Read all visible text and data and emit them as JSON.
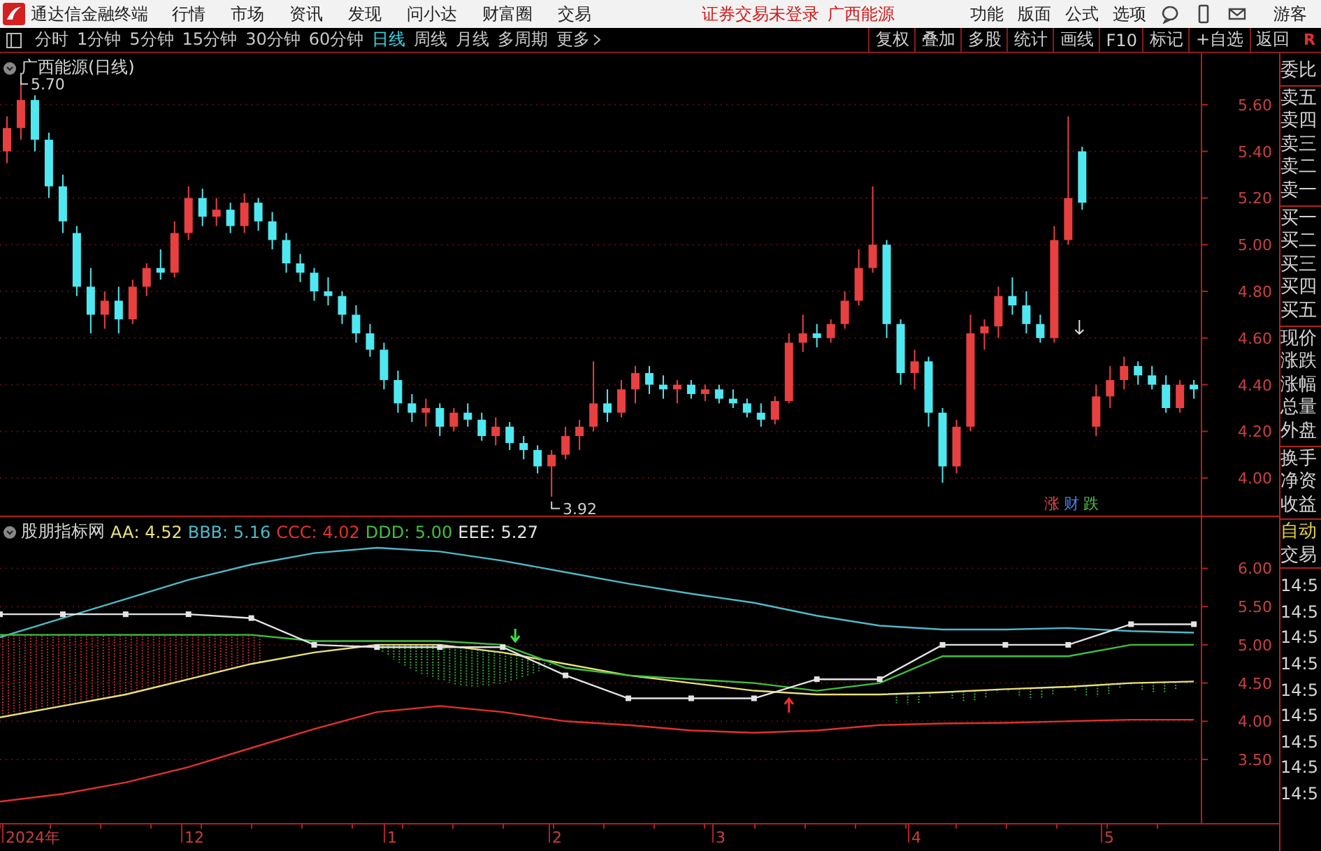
{
  "title_bar": {
    "app_name": "通达信金融终端",
    "menu": [
      "行情",
      "市场",
      "资讯",
      "发现",
      "问小达",
      "财富圈",
      "交易"
    ],
    "login_status": "证券交易未登录",
    "stock_name": "广西能源",
    "tools": [
      "功能",
      "版面",
      "公式",
      "选项"
    ],
    "user": "游客"
  },
  "period_bar": {
    "periods": [
      {
        "label": "分时",
        "selected": false
      },
      {
        "label": "1分钟",
        "selected": false
      },
      {
        "label": "5分钟",
        "selected": false
      },
      {
        "label": "15分钟",
        "selected": false
      },
      {
        "label": "30分钟",
        "selected": false
      },
      {
        "label": "60分钟",
        "selected": false
      },
      {
        "label": "日线",
        "selected": true
      },
      {
        "label": "周线",
        "selected": false
      },
      {
        "label": "月线",
        "selected": false
      },
      {
        "label": "多周期",
        "selected": false
      }
    ],
    "more": "更多",
    "actions": [
      "复权",
      "叠加",
      "多股",
      "统计",
      "画线",
      "F10",
      "标记",
      "+自选",
      "返回"
    ],
    "corner": "R"
  },
  "main_chart": {
    "title": "广西能源(日线)",
    "high_label": "5.70",
    "low_label": "3.92",
    "markers": [
      {
        "text": "涨",
        "color": "#e8484a"
      },
      {
        "text": "财",
        "color": "#4a7fe0"
      },
      {
        "text": "跌",
        "color": "#4ec24e"
      }
    ],
    "chart_data": {
      "type": "candlestick",
      "grid": true,
      "ylim": [
        3.84,
        5.82
      ],
      "categories": [
        null,
        null,
        null,
        null,
        null,
        null,
        null,
        null,
        null,
        null,
        null,
        null,
        null,
        null,
        null,
        null,
        null,
        null,
        null,
        null,
        null,
        null,
        null,
        null,
        null,
        null,
        null,
        null,
        null,
        null,
        null,
        null,
        null,
        null,
        null,
        null,
        null,
        null,
        null,
        null,
        null,
        null,
        null,
        null,
        null,
        null,
        null,
        null,
        null,
        null,
        null,
        null,
        null,
        null,
        null,
        null,
        null,
        null,
        null,
        null,
        null,
        null,
        null,
        null,
        null,
        null,
        null,
        null,
        null,
        null,
        null,
        null,
        null,
        null,
        null,
        null,
        null,
        null,
        null,
        null,
        null,
        null,
        null,
        null,
        null,
        null
      ],
      "yticks": [
        {
          "value": 5.6,
          "label": "5.60"
        },
        {
          "value": 5.4,
          "label": "5.40"
        },
        {
          "value": 5.2,
          "label": "5.20"
        },
        {
          "value": 5,
          "label": "5.00"
        },
        {
          "value": 4.8,
          "label": "4.80"
        },
        {
          "value": 4.6,
          "label": "4.60"
        },
        {
          "value": 4.4,
          "label": "4.40"
        },
        {
          "value": 4.2,
          "label": "4.20"
        },
        {
          "value": 4,
          "label": "4.00"
        }
      ],
      "ohlc": [
        [
          5.4,
          5.55,
          5.35,
          5.5
        ],
        [
          5.5,
          5.7,
          5.45,
          5.62
        ],
        [
          5.62,
          5.64,
          5.4,
          5.45
        ],
        [
          5.45,
          5.48,
          5.2,
          5.25
        ],
        [
          5.25,
          5.3,
          5.05,
          5.1
        ],
        [
          5.05,
          5.08,
          4.78,
          4.82
        ],
        [
          4.82,
          4.9,
          4.62,
          4.7
        ],
        [
          4.7,
          4.8,
          4.64,
          4.76
        ],
        [
          4.76,
          4.82,
          4.62,
          4.68
        ],
        [
          4.68,
          4.85,
          4.66,
          4.82
        ],
        [
          4.82,
          4.92,
          4.78,
          4.9
        ],
        [
          4.9,
          4.98,
          4.85,
          4.88
        ],
        [
          4.88,
          5.1,
          4.86,
          5.05
        ],
        [
          5.05,
          5.25,
          5.02,
          5.2
        ],
        [
          5.2,
          5.24,
          5.08,
          5.12
        ],
        [
          5.12,
          5.2,
          5.08,
          5.15
        ],
        [
          5.15,
          5.18,
          5.05,
          5.08
        ],
        [
          5.08,
          5.22,
          5.05,
          5.18
        ],
        [
          5.18,
          5.2,
          5.06,
          5.1
        ],
        [
          5.1,
          5.14,
          4.98,
          5.02
        ],
        [
          5.02,
          5.05,
          4.88,
          4.92
        ],
        [
          4.92,
          4.96,
          4.84,
          4.88
        ],
        [
          4.88,
          4.9,
          4.76,
          4.8
        ],
        [
          4.8,
          4.86,
          4.74,
          4.78
        ],
        [
          4.78,
          4.8,
          4.66,
          4.7
        ],
        [
          4.7,
          4.74,
          4.58,
          4.62
        ],
        [
          4.62,
          4.66,
          4.52,
          4.55
        ],
        [
          4.55,
          4.58,
          4.38,
          4.42
        ],
        [
          4.42,
          4.46,
          4.28,
          4.32
        ],
        [
          4.32,
          4.36,
          4.24,
          4.28
        ],
        [
          4.28,
          4.34,
          4.22,
          4.3
        ],
        [
          4.3,
          4.32,
          4.18,
          4.22
        ],
        [
          4.22,
          4.3,
          4.2,
          4.28
        ],
        [
          4.28,
          4.32,
          4.22,
          4.25
        ],
        [
          4.25,
          4.28,
          4.16,
          4.18
        ],
        [
          4.18,
          4.26,
          4.14,
          4.22
        ],
        [
          4.22,
          4.24,
          4.12,
          4.15
        ],
        [
          4.15,
          4.18,
          4.08,
          4.12
        ],
        [
          4.12,
          4.14,
          4.02,
          4.05
        ],
        [
          4.05,
          4.12,
          3.92,
          4.1
        ],
        [
          4.1,
          4.22,
          4.08,
          4.18
        ],
        [
          4.18,
          4.25,
          4.12,
          4.22
        ],
        [
          4.22,
          4.5,
          4.2,
          4.32
        ],
        [
          4.32,
          4.38,
          4.24,
          4.28
        ],
        [
          4.28,
          4.42,
          4.26,
          4.38
        ],
        [
          4.38,
          4.48,
          4.32,
          4.45
        ],
        [
          4.45,
          4.48,
          4.36,
          4.4
        ],
        [
          4.4,
          4.44,
          4.34,
          4.38
        ],
        [
          4.38,
          4.42,
          4.32,
          4.4
        ],
        [
          4.4,
          4.42,
          4.34,
          4.36
        ],
        [
          4.36,
          4.4,
          4.33,
          4.38
        ],
        [
          4.38,
          4.4,
          4.32,
          4.34
        ],
        [
          4.34,
          4.38,
          4.3,
          4.32
        ],
        [
          4.32,
          4.34,
          4.26,
          4.28
        ],
        [
          4.28,
          4.32,
          4.22,
          4.25
        ],
        [
          4.25,
          4.35,
          4.23,
          4.33
        ],
        [
          4.33,
          4.62,
          4.32,
          4.58
        ],
        [
          4.58,
          4.7,
          4.54,
          4.62
        ],
        [
          4.62,
          4.66,
          4.56,
          4.6
        ],
        [
          4.6,
          4.68,
          4.58,
          4.66
        ],
        [
          4.66,
          4.8,
          4.64,
          4.76
        ],
        [
          4.76,
          4.98,
          4.74,
          4.9
        ],
        [
          4.9,
          5.25,
          4.88,
          5.0
        ],
        [
          5.0,
          5.02,
          4.6,
          4.66
        ],
        [
          4.66,
          4.68,
          4.4,
          4.45
        ],
        [
          4.45,
          4.55,
          4.38,
          4.5
        ],
        [
          4.5,
          4.52,
          4.22,
          4.28
        ],
        [
          4.28,
          4.3,
          3.98,
          4.05
        ],
        [
          4.05,
          4.25,
          4.02,
          4.22
        ],
        [
          4.22,
          4.7,
          4.2,
          4.62
        ],
        [
          4.62,
          4.68,
          4.55,
          4.65
        ],
        [
          4.65,
          4.82,
          4.6,
          4.78
        ],
        [
          4.78,
          4.86,
          4.7,
          4.74
        ],
        [
          4.74,
          4.8,
          4.62,
          4.66
        ],
        [
          4.66,
          4.7,
          4.58,
          4.6
        ],
        [
          4.6,
          5.08,
          4.58,
          5.02
        ],
        [
          5.02,
          5.55,
          5.0,
          5.2
        ],
        [
          5.4,
          5.42,
          5.15,
          5.18
        ],
        [
          4.22,
          4.4,
          4.18,
          4.35
        ],
        [
          4.35,
          4.48,
          4.3,
          4.42
        ],
        [
          4.42,
          4.52,
          4.38,
          4.48
        ],
        [
          4.48,
          4.5,
          4.4,
          4.44
        ],
        [
          4.44,
          4.48,
          4.38,
          4.4
        ],
        [
          4.4,
          4.44,
          4.28,
          4.3
        ],
        [
          4.3,
          4.42,
          4.28,
          4.4
        ],
        [
          4.4,
          4.42,
          4.34,
          4.38
        ]
      ]
    }
  },
  "indicator": {
    "name": "股朋指标网",
    "legend": [
      ": 4.52",
      ": 5.16",
      ": 4.02",
      ": 5.00",
      ": 5.27"
    ],
    "chart_data": {
      "type": "line",
      "grid": true,
      "ylim": [
        2.67,
        6.67
      ],
      "categories": [
        null,
        null,
        null,
        null,
        null,
        null,
        null,
        null,
        null,
        null,
        null,
        null,
        null,
        null,
        null,
        null,
        null,
        null,
        null,
        null
      ],
      "yticks": [
        {
          "value": 6,
          "label": "6.00"
        },
        {
          "value": 5.5,
          "label": "5.50"
        },
        {
          "value": 5,
          "label": "5.00"
        },
        {
          "value": 4.5,
          "label": "4.50"
        },
        {
          "value": 4,
          "label": "4.00"
        },
        {
          "value": 3.5,
          "label": "3.50"
        }
      ],
      "series": [
        {
          "name": "AA",
          "color": "#e8e07a",
          "values": [
            4.05,
            4.2,
            4.35,
            4.55,
            4.75,
            4.9,
            5.0,
            5.0,
            4.9,
            4.75,
            4.6,
            4.5,
            4.4,
            4.35,
            4.35,
            4.38,
            4.42,
            4.45,
            4.5,
            4.52
          ]
        },
        {
          "name": "BBB",
          "color": "#4fb8c8",
          "values": [
            5.1,
            5.35,
            5.6,
            5.85,
            6.05,
            6.2,
            6.27,
            6.22,
            6.1,
            5.95,
            5.8,
            5.67,
            5.55,
            5.38,
            5.25,
            5.2,
            5.2,
            5.22,
            5.18,
            5.16
          ]
        },
        {
          "name": "CCC",
          "color": "#e03030",
          "values": [
            2.95,
            3.05,
            3.2,
            3.4,
            3.65,
            3.9,
            4.12,
            4.2,
            4.12,
            4.0,
            3.95,
            3.88,
            3.85,
            3.88,
            3.95,
            3.97,
            3.98,
            4.0,
            4.02,
            4.02
          ]
        },
        {
          "name": "DDD",
          "color": "#40c040",
          "values": [
            5.13,
            5.13,
            5.13,
            5.13,
            5.13,
            5.05,
            5.05,
            5.05,
            5.0,
            4.7,
            4.6,
            4.55,
            4.5,
            4.4,
            4.5,
            4.85,
            4.85,
            4.85,
            5.0,
            5.0
          ]
        },
        {
          "name": "EEE",
          "color": "#e4e4e4",
          "marker": "square",
          "values": [
            5.4,
            5.4,
            5.4,
            5.4,
            5.35,
            5.0,
            4.97,
            4.97,
            4.97,
            4.6,
            4.3,
            4.3,
            4.3,
            4.55,
            4.55,
            5.0,
            5.0,
            5.0,
            5.27,
            5.27
          ]
        }
      ]
    }
  },
  "date_axis": {
    "labels": [
      "2024年",
      "12",
      "1",
      "2",
      "3",
      "4",
      "5"
    ]
  },
  "side_panel": {
    "quote_groups": [
      [
        "委比"
      ],
      [
        "卖五",
        "卖四",
        "卖三",
        "卖二",
        "卖一"
      ],
      [
        "买一",
        "买二",
        "买三",
        "买四",
        "买五"
      ],
      [
        "现价",
        "涨跌",
        "涨幅",
        "总量",
        "外盘"
      ],
      [
        "换手",
        "净资",
        "收益"
      ]
    ],
    "trade_tabs": [
      {
        "label": "自动",
        "selected": true
      },
      {
        "label": "交易",
        "selected": false
      }
    ],
    "times": [
      "14:5",
      "14:5",
      "14:5",
      "14:5",
      "14:5",
      "14:5",
      "14:5",
      "14:5",
      "14:5"
    ]
  }
}
